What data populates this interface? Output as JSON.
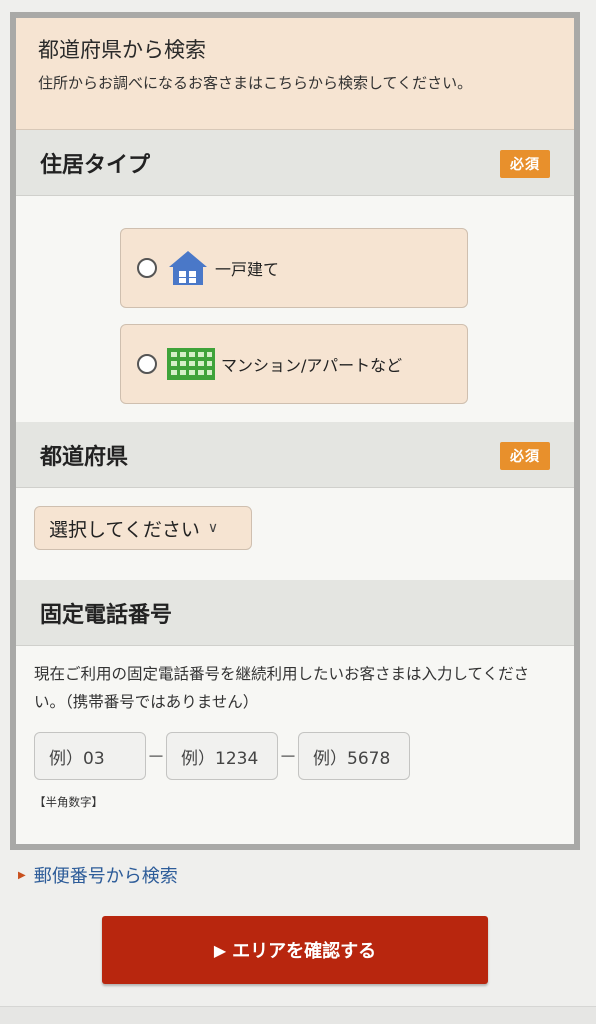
{
  "header": {
    "title": "都道府県から検索",
    "description": "住所からお調べになるお客さまはこちらから検索してください。"
  },
  "housing_type": {
    "label": "住居タイプ",
    "required_badge": "必須",
    "options": [
      {
        "label": "一戸建て",
        "icon": "house-icon",
        "selected": false
      },
      {
        "label": "マンション/アパートなど",
        "icon": "apartment-icon",
        "selected": false
      }
    ]
  },
  "prefecture": {
    "label": "都道府県",
    "required_badge": "必須",
    "select_value": "選択してください"
  },
  "landline": {
    "label": "固定電話番号",
    "description": "現在ご利用の固定電話番号を継続利用したいお客さまは入力してください。（携帯番号ではありません）",
    "placeholders": [
      "例）03",
      "例）1234",
      "例）5678"
    ],
    "separator": "－",
    "note": "【半角数字】"
  },
  "postal_link": "郵便番号から検索",
  "confirm_button": "エリアを確認する",
  "colors": {
    "accent_orange": "#e8902c",
    "button_red": "#b8260e",
    "link_blue": "#2d5c99",
    "option_bg": "#f6e4d2",
    "icon_blue": "#4a78c8",
    "icon_green": "#3fa33a"
  }
}
